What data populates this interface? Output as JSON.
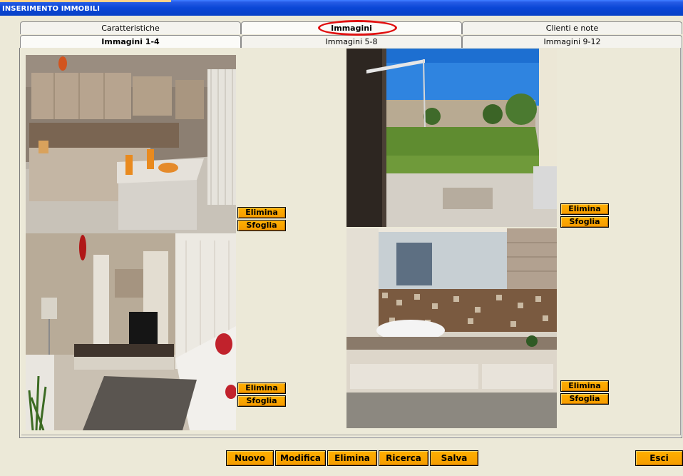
{
  "window": {
    "title": "INSERIMENTO IMMOBILI"
  },
  "tabs": {
    "main": [
      {
        "label": "Caratteristiche"
      },
      {
        "label": "Immagini"
      },
      {
        "label": "Clienti e note"
      }
    ],
    "sub": [
      {
        "label": "Immagini 1-4"
      },
      {
        "label": "Immagini 5-8"
      },
      {
        "label": "Immagini 9-12"
      }
    ],
    "selected_main": "Immagini",
    "selected_sub": "Immagini 1-4"
  },
  "images": [
    {
      "subject": "kitchen",
      "delete_label": "Elimina",
      "browse_label": "Sfoglia"
    },
    {
      "subject": "garden",
      "delete_label": "Elimina",
      "browse_label": "Sfoglia"
    },
    {
      "subject": "living-room",
      "delete_label": "Elimina",
      "browse_label": "Sfoglia"
    },
    {
      "subject": "bathroom",
      "delete_label": "Elimina",
      "browse_label": "Sfoglia"
    }
  ],
  "footer": {
    "new_label": "Nuovo",
    "edit_label": "Modifica",
    "delete_label": "Elimina",
    "search_label": "Ricerca",
    "save_label": "Salva",
    "exit_label": "Esci"
  },
  "colors": {
    "window_bg": "#ece9d8",
    "titlebar": "#0a46d6",
    "button": "#f59b00",
    "highlight_ellipse": "#e01010"
  }
}
